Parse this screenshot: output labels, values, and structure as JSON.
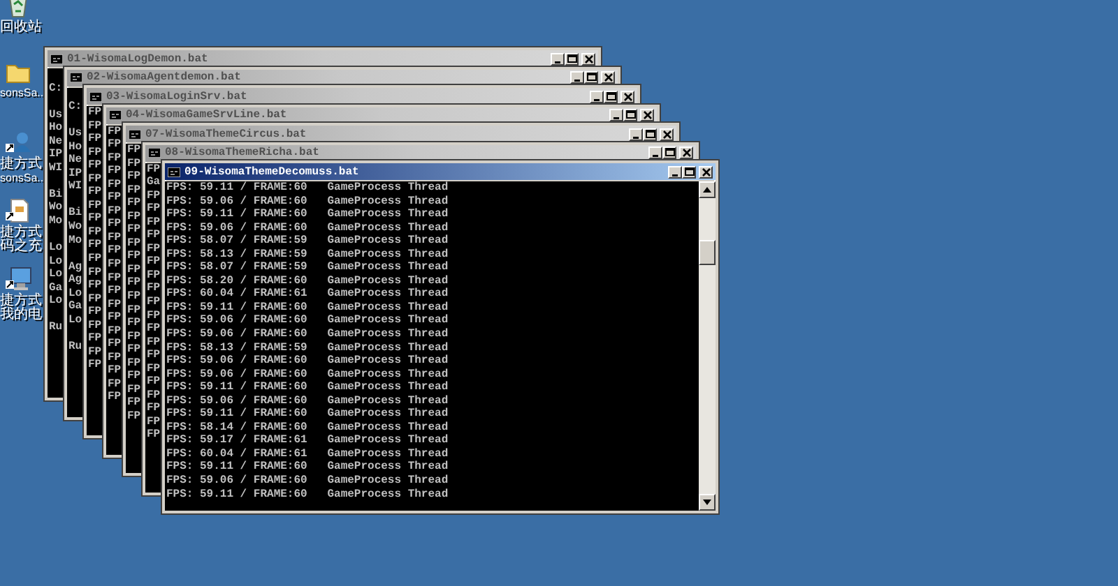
{
  "desktop_icons": [
    {
      "kind": "recycle-bin",
      "label": [
        "回收站"
      ]
    },
    {
      "kind": "folder",
      "label": [
        "sonsSa.."
      ]
    },
    {
      "kind": "app-shortcut",
      "label": [
        "捷方式",
        "sonsSa.."
      ]
    },
    {
      "kind": "document-shortcut",
      "label": [
        "捷方式",
        "码之充"
      ]
    },
    {
      "kind": "computer-shortcut",
      "label": [
        "捷方式",
        "我的电"
      ]
    }
  ],
  "windows": [
    {
      "title": "01-WisomaLogDemon.bat",
      "active": false,
      "blocks": [
        [
          "C:"
        ],
        [
          "Us",
          "Ho",
          "Ne",
          "IP",
          "WI"
        ],
        [
          "Bi",
          "Wo",
          "Mo"
        ],
        [
          "Lo",
          "Lo",
          "Lo",
          "Ga",
          "Lo"
        ],
        [
          "Ru"
        ]
      ]
    },
    {
      "title": "02-WisomaAgentdemon.bat",
      "active": false,
      "blocks": [
        [
          "C:"
        ],
        [
          "Us",
          "Ho",
          "Ne",
          "IP",
          "WI"
        ],
        [
          "Bi",
          "Wo",
          "Mo"
        ],
        [
          "Ag",
          "Ag",
          "Lo",
          "Ga",
          "Lo"
        ],
        [
          "Ru"
        ]
      ]
    },
    {
      "title": "03-WisomaLoginSrv.bat",
      "active": false,
      "lines": [
        "FP",
        "FP",
        "FP",
        "FP",
        "FP",
        "FP",
        "FP",
        "FP",
        "FP",
        "FP",
        "FP",
        "FP",
        "FP",
        "FP",
        "FP",
        "FP",
        "FP",
        "FP",
        "FP",
        "FP"
      ]
    },
    {
      "title": "04-WisomaGameSrvLine.bat",
      "active": false,
      "lines": [
        "FP",
        "FP",
        "FP",
        "FP",
        "FP",
        "FP",
        "FP",
        "FP",
        "FP",
        "FP",
        "FP",
        "FP",
        "FP",
        "FP",
        "FP",
        "FP",
        "FP",
        "FP",
        "FP",
        "FP",
        "FP"
      ]
    },
    {
      "title": "07-WisomaThemeCircus.bat",
      "active": false,
      "lines": [
        "FP",
        "FP",
        "FP",
        "FP",
        "FP",
        "FP",
        "FP",
        "FP",
        "FP",
        "FP",
        "FP",
        "FP",
        "FP",
        "FP",
        "FP",
        "FP",
        "FP",
        "FP",
        "FP",
        "FP",
        "FP"
      ]
    },
    {
      "title": "08-WisomaThemeRicha.bat",
      "active": false,
      "lines": [
        "FP",
        "Ga",
        "FP",
        "FP",
        "FP",
        "FP",
        "FP",
        "FP",
        "FP",
        "FP",
        "FP",
        "FP",
        "FP",
        "FP",
        "FP",
        "FP",
        "FP",
        "FP",
        "FP",
        "FP",
        "FP"
      ]
    },
    {
      "title": "09-WisomaThemeDecomuss.bat",
      "active": true,
      "lines": [
        "FPS: 59.11 / FRAME:60   GameProcess Thread",
        "FPS: 59.06 / FRAME:60   GameProcess Thread",
        "FPS: 59.11 / FRAME:60   GameProcess Thread",
        "FPS: 59.06 / FRAME:60   GameProcess Thread",
        "FPS: 58.07 / FRAME:59   GameProcess Thread",
        "FPS: 58.13 / FRAME:59   GameProcess Thread",
        "FPS: 58.07 / FRAME:59   GameProcess Thread",
        "FPS: 58.20 / FRAME:60   GameProcess Thread",
        "FPS: 60.04 / FRAME:61   GameProcess Thread",
        "FPS: 59.11 / FRAME:60   GameProcess Thread",
        "FPS: 59.06 / FRAME:60   GameProcess Thread",
        "FPS: 59.06 / FRAME:60   GameProcess Thread",
        "FPS: 58.13 / FRAME:59   GameProcess Thread",
        "FPS: 59.06 / FRAME:60   GameProcess Thread",
        "FPS: 59.06 / FRAME:60   GameProcess Thread",
        "FPS: 59.11 / FRAME:60   GameProcess Thread",
        "FPS: 59.06 / FRAME:60   GameProcess Thread",
        "FPS: 59.11 / FRAME:60   GameProcess Thread",
        "FPS: 58.14 / FRAME:60   GameProcess Thread",
        "FPS: 59.17 / FRAME:61   GameProcess Thread",
        "FPS: 60.04 / FRAME:61   GameProcess Thread",
        "FPS: 59.11 / FRAME:60   GameProcess Thread",
        "FPS: 59.06 / FRAME:60   GameProcess Thread",
        "FPS: 59.11 / FRAME:60   GameProcess Thread"
      ]
    }
  ]
}
